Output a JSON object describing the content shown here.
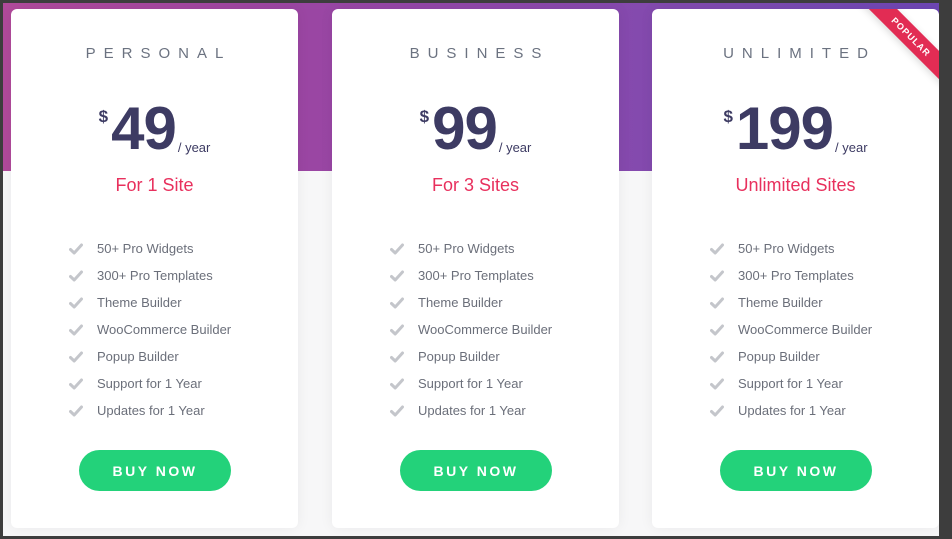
{
  "colors": {
    "accent_pink": "#e8305d",
    "button_green": "#23d27a",
    "price_navy": "#3d3b63",
    "ribbon_red": "#e22c54",
    "band_gradient_start": "#b14a9b",
    "band_gradient_end": "#6d46b4"
  },
  "plans": [
    {
      "name": "PERSONAL",
      "currency": "$",
      "amount": "49",
      "period": "/ year",
      "sites": "For 1 Site",
      "features": [
        "50+ Pro Widgets",
        "300+ Pro Templates",
        "Theme Builder",
        "WooCommerce Builder",
        "Popup Builder",
        "Support for 1 Year",
        "Updates for 1 Year"
      ],
      "button_label": "BUY NOW"
    },
    {
      "name": "BUSINESS",
      "currency": "$",
      "amount": "99",
      "period": "/ year",
      "sites": "For 3 Sites",
      "features": [
        "50+ Pro Widgets",
        "300+ Pro Templates",
        "Theme Builder",
        "WooCommerce Builder",
        "Popup Builder",
        "Support for 1 Year",
        "Updates for 1 Year"
      ],
      "button_label": "BUY NOW"
    },
    {
      "name": "UNLIMITED",
      "currency": "$",
      "amount": "199",
      "period": "/ year",
      "sites": "Unlimited Sites",
      "features": [
        "50+ Pro Widgets",
        "300+ Pro Templates",
        "Theme Builder",
        "WooCommerce Builder",
        "Popup Builder",
        "Support for 1 Year",
        "Updates for 1 Year"
      ],
      "button_label": "BUY NOW",
      "ribbon": "POPULAR"
    }
  ],
  "icons": {
    "feature_bullet": "check-icon"
  }
}
